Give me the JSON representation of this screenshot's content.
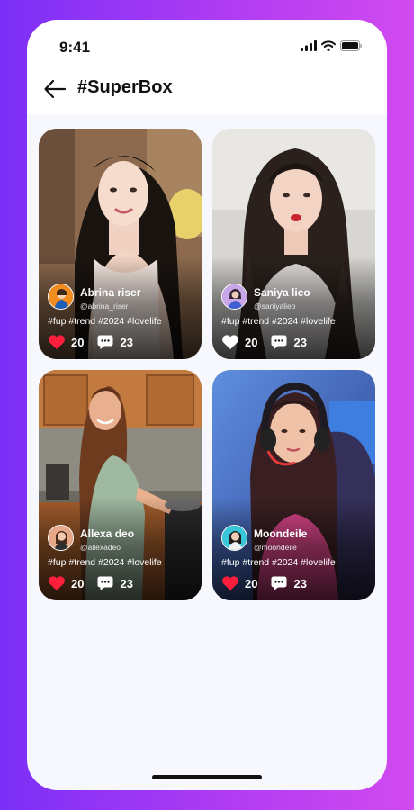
{
  "status": {
    "time": "9:41"
  },
  "header": {
    "title": "#SuperBox"
  },
  "colors": {
    "like_active": "#ff1f3d",
    "like_inactive": "#ffffff"
  },
  "posts": [
    {
      "name": "Abrina riser",
      "handle": "@abrina_riser",
      "tags": "#fup #trend #2024 #lovelife",
      "likes": "20",
      "comments": "23",
      "liked": true
    },
    {
      "name": "Saniya lieo",
      "handle": "@saniyalieo",
      "tags": "#fup #trend #2024 #lovelife",
      "likes": "20",
      "comments": "23",
      "liked": false
    },
    {
      "name": "Allexa deo",
      "handle": "@allexadeo",
      "tags": "#fup #trend #2024 #lovelife",
      "likes": "20",
      "comments": "23",
      "liked": true
    },
    {
      "name": "Moondeile",
      "handle": "@moondeile",
      "tags": "#fup #trend #2024 #lovelife",
      "likes": "20",
      "comments": "23",
      "liked": true
    }
  ]
}
